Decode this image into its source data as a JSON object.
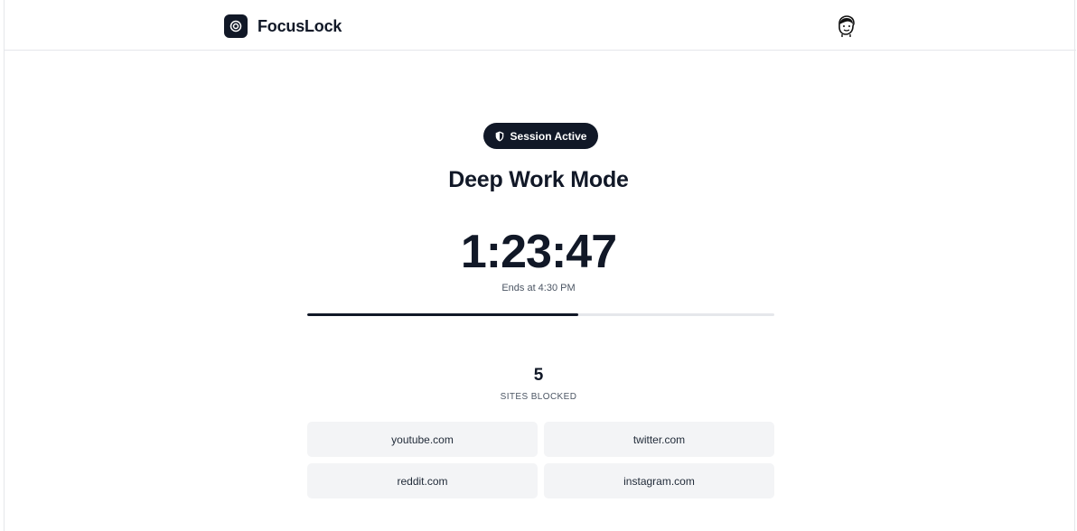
{
  "app": {
    "title": "FocusLock"
  },
  "session": {
    "status": "Session Active",
    "mode": "Deep Work Mode",
    "time_remaining": "1:23:47",
    "ends_at": "Ends at 4:30 PM",
    "progress_percent": 58
  },
  "blocked": {
    "count": "5",
    "label": "SITES BLOCKED",
    "sites": [
      "youtube.com",
      "twitter.com",
      "reddit.com",
      "instagram.com"
    ]
  },
  "icons": {
    "logo": "target-icon",
    "badge": "shield-icon",
    "avatar": "user-avatar"
  },
  "colors": {
    "accent": "#111827",
    "track": "#e5e7eb",
    "chip": "#f3f4f6"
  }
}
